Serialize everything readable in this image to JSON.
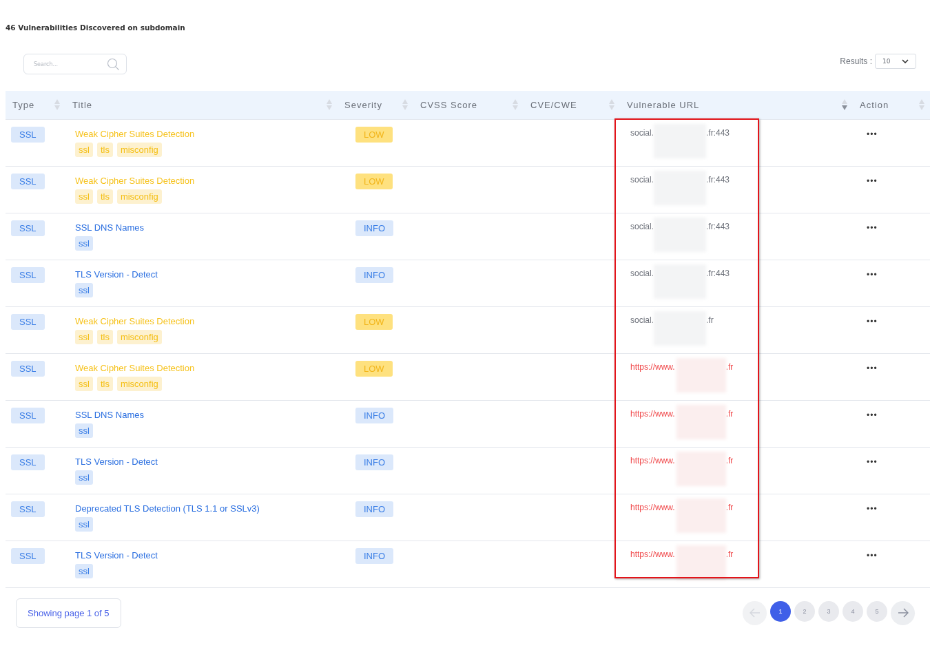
{
  "heading": "46 Vulnerabilities Discovered on subdomain",
  "search": {
    "placeholder": "Search..."
  },
  "results": {
    "label": "Results :",
    "value": "10"
  },
  "table": {
    "columns": [
      {
        "label": "Type",
        "sorted": false
      },
      {
        "label": "Title",
        "sorted": false
      },
      {
        "label": "Severity",
        "sorted": false
      },
      {
        "label": "CVSS Score",
        "sorted": false
      },
      {
        "label": "CVE/CWE",
        "sorted": false
      },
      {
        "label": "Vulnerable URL",
        "sorted": true
      },
      {
        "label": "Action",
        "sorted": false
      }
    ],
    "rows": [
      {
        "type": "SSL",
        "title": "Weak Cipher Suites Detection",
        "tags": [
          "ssl",
          "tls",
          "misconfig"
        ],
        "severity": {
          "label": "LOW",
          "kind": "low"
        },
        "url": {
          "kind": "host",
          "start": "social.",
          "end": ".fr:443"
        },
        "action": "•••"
      },
      {
        "type": "SSL",
        "title": "Weak Cipher Suites Detection",
        "tags": [
          "ssl",
          "tls",
          "misconfig"
        ],
        "severity": {
          "label": "LOW",
          "kind": "low"
        },
        "url": {
          "kind": "host",
          "start": "social.",
          "end": ".fr:443"
        },
        "action": "•••"
      },
      {
        "type": "SSL",
        "title": "SSL DNS Names",
        "tags": [
          "ssl"
        ],
        "severity": {
          "label": "INFO",
          "kind": "info"
        },
        "url": {
          "kind": "host",
          "start": "social.",
          "end": ".fr:443"
        },
        "action": "•••"
      },
      {
        "type": "SSL",
        "title": "TLS Version - Detect",
        "tags": [
          "ssl"
        ],
        "severity": {
          "label": "INFO",
          "kind": "info"
        },
        "url": {
          "kind": "host",
          "start": "social.",
          "end": ".fr:443"
        },
        "action": "•••"
      },
      {
        "type": "SSL",
        "title": "Weak Cipher Suites Detection",
        "tags": [
          "ssl",
          "tls",
          "misconfig"
        ],
        "severity": {
          "label": "LOW",
          "kind": "low"
        },
        "url": {
          "kind": "host",
          "start": "social.",
          "end": ".fr"
        },
        "action": "•••"
      },
      {
        "type": "SSL",
        "title": "Weak Cipher Suites Detection",
        "tags": [
          "ssl",
          "tls",
          "misconfig"
        ],
        "severity": {
          "label": "LOW",
          "kind": "low"
        },
        "url": {
          "kind": "link",
          "start": "https://www.",
          "end": ".fr"
        },
        "action": "•••"
      },
      {
        "type": "SSL",
        "title": "SSL DNS Names",
        "tags": [
          "ssl"
        ],
        "severity": {
          "label": "INFO",
          "kind": "info"
        },
        "url": {
          "kind": "link",
          "start": "https://www.",
          "end": ".fr"
        },
        "action": "•••"
      },
      {
        "type": "SSL",
        "title": "TLS Version - Detect",
        "tags": [
          "ssl"
        ],
        "severity": {
          "label": "INFO",
          "kind": "info"
        },
        "url": {
          "kind": "link",
          "start": "https://www.",
          "end": ".fr"
        },
        "action": "•••"
      },
      {
        "type": "SSL",
        "title": "Deprecated TLS Detection (TLS 1.1 or SSLv3)",
        "tags": [
          "ssl"
        ],
        "severity": {
          "label": "INFO",
          "kind": "info"
        },
        "url": {
          "kind": "link",
          "start": "https://www.",
          "end": ".fr"
        },
        "action": "•••"
      },
      {
        "type": "SSL",
        "title": "TLS Version - Detect",
        "tags": [
          "ssl"
        ],
        "severity": {
          "label": "INFO",
          "kind": "info"
        },
        "url": {
          "kind": "link",
          "start": "https://www.",
          "end": ".fr"
        },
        "action": "•••"
      }
    ]
  },
  "footer": {
    "status": "Showing page 1 of 5",
    "pages": [
      {
        "label": "1",
        "selected": true
      },
      {
        "label": "2",
        "selected": false
      },
      {
        "label": "3",
        "selected": false
      },
      {
        "label": "4",
        "selected": false
      },
      {
        "label": "5",
        "selected": false
      }
    ]
  }
}
